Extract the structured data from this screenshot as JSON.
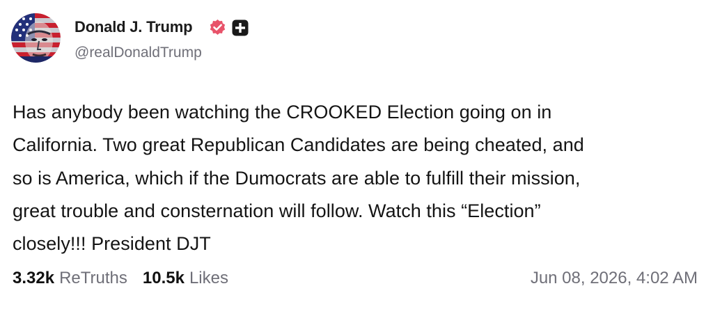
{
  "author": {
    "name": "Donald J. Trump",
    "handle": "@realDonaldTrump",
    "avatar_icon": "portrait-avatar-icon",
    "verified_icon": "verified-badge-icon",
    "platform_icon": "truth-social-icon",
    "verified_color": "#e8536a"
  },
  "post": {
    "text": "Has anybody been watching the CROOKED Election going on in\nCalifornia. Two great Republican Candidates are being cheated, and\nso is America, which if the Dumocrats are able to fulfill their mission,\ngreat trouble and consternation will follow. Watch this “Election”\nclosely!!! President DJT"
  },
  "stats": {
    "retruths_count": "3.32k",
    "retruths_label": "ReTruths",
    "likes_count": "10.5k",
    "likes_label": "Likes"
  },
  "timestamp": "Jun 08, 2026, 4:02 AM"
}
